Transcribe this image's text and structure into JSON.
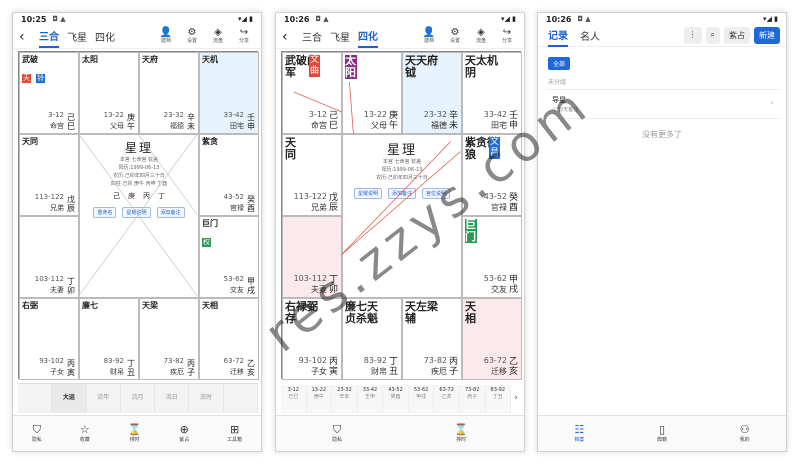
{
  "watermark": "res.zzys.com",
  "phone1": {
    "status": {
      "time": "10:25",
      "icons": "◘ ▲",
      "right": "▾◢ ▮"
    },
    "tabs": [
      "三合",
      "飞星",
      "四化"
    ],
    "actions": [
      {
        "icon": "👤",
        "label": "建档"
      },
      {
        "icon": "⚙",
        "label": "设置"
      },
      {
        "icon": "◈",
        "label": "流盘"
      },
      {
        "icon": "↪",
        "label": "分享"
      }
    ],
    "center": {
      "title": "星理",
      "lines": [
        "本宫 七命宫 钦差",
        "阳历:1999-06-13",
        "农历:己卯年四月三十日",
        "四柱 己卯 庚午 丙申 丁酉"
      ],
      "pillars": [
        "己",
        "庚",
        "丙",
        "丁"
      ],
      "buttons": [
        "重命名",
        "星曜说明",
        "添加备注"
      ]
    },
    "cells": [
      {
        "stars": "武破",
        "badges": [
          "天",
          "铃"
        ],
        "range": "3-12",
        "palace": "命宫",
        "branch": "己巳"
      },
      {
        "stars": "太阳",
        "badges": [],
        "range": "13-22",
        "palace": "父母",
        "branch": "庚午"
      },
      {
        "stars": "天府",
        "badges": [],
        "range": "23-32",
        "palace": "福德",
        "branch": "辛未"
      },
      {
        "stars": "天机",
        "badges": [],
        "range": "33-42",
        "palace": "田宅",
        "branch": "壬申"
      },
      {
        "stars": "天同",
        "badges": [],
        "range": "113-122",
        "palace": "兄弟",
        "branch": "戊辰"
      },
      {
        "stars": "紫贪",
        "badges": [],
        "range": "43-52",
        "palace": "官禄",
        "branch": "癸酉"
      },
      {
        "stars": "",
        "badges": [],
        "range": "103-112",
        "palace": "夫妻",
        "branch": "丁卯"
      },
      {
        "stars": "巨门",
        "badges": [
          "权"
        ],
        "range": "53-62",
        "palace": "交友",
        "branch": "甲戌"
      },
      {
        "stars": "右弼",
        "badges": [],
        "range": "93-102",
        "palace": "子女",
        "branch": "丙寅"
      },
      {
        "stars": "廉七",
        "badges": [],
        "range": "83-92",
        "palace": "财帛",
        "branch": "丁丑"
      },
      {
        "stars": "天梁",
        "badges": [],
        "range": "73-82",
        "palace": "疾厄",
        "branch": "丙子"
      },
      {
        "stars": "天相",
        "badges": [],
        "range": "63-72",
        "palace": "迁移",
        "branch": "乙亥"
      }
    ],
    "strip": [
      "",
      "大运",
      "流年",
      "流月",
      "流日",
      "流时",
      ""
    ],
    "bottom": [
      {
        "icon": "⛉",
        "label": "隐私"
      },
      {
        "icon": "☆",
        "label": "收藏"
      },
      {
        "icon": "⌛",
        "label": "排时"
      },
      {
        "icon": "⊕",
        "label": "紫占"
      },
      {
        "icon": "⊞",
        "label": "工具箱"
      }
    ]
  },
  "phone2": {
    "status": {
      "time": "10:26",
      "icons": "◘ ▲",
      "right": "▾◢ ▮"
    },
    "tabs": [
      "三合",
      "飞星",
      "四化"
    ],
    "actions": [
      {
        "icon": "👤",
        "label": "建档"
      },
      {
        "icon": "⚙",
        "label": "设置"
      },
      {
        "icon": "◈",
        "label": "流盘"
      },
      {
        "icon": "↪",
        "label": "分享"
      }
    ],
    "center": {
      "title": "星理",
      "lines": [
        "本宫 七命宫 钦差",
        "阳历:1999-06-13",
        "农历:己卯年四月三十日"
      ],
      "buttons": [
        "星曜说明",
        "添加备注",
        "宫位说明"
      ]
    },
    "cells": [
      {
        "stars": "武破曲军",
        "badges": [
          "文曲"
        ],
        "range": "3-12",
        "palace": "命宫",
        "branch": "己巳"
      },
      {
        "stars": "太阳",
        "badges": [],
        "range": "13-22",
        "palace": "父母",
        "branch": "庚午"
      },
      {
        "stars": "天天府钺",
        "badges": [],
        "range": "23-32",
        "palace": "福德",
        "branch": "辛未"
      },
      {
        "stars": "天太机阴",
        "badges": [],
        "range": "33-42",
        "palace": "田宅",
        "branch": "壬申"
      },
      {
        "stars": "天同",
        "badges": [],
        "range": "113-122",
        "palace": "兄弟",
        "branch": "戊辰"
      },
      {
        "stars": "紫贪微狼",
        "badges": [
          "文昌"
        ],
        "range": "43-52",
        "palace": "官禄",
        "branch": "癸酉"
      },
      {
        "stars": "",
        "badges": [],
        "range": "103-112",
        "palace": "夫妻",
        "branch": "丁卯"
      },
      {
        "stars": "巨门",
        "badges": [],
        "range": "53-62",
        "palace": "交友",
        "branch": "甲戌"
      },
      {
        "stars": "右禄弼存",
        "badges": [],
        "range": "93-102",
        "palace": "子女",
        "branch": "丙寅"
      },
      {
        "stars": "廉七天贞杀魁",
        "badges": [],
        "range": "83-92",
        "palace": "财帛",
        "branch": "丁丑"
      },
      {
        "stars": "天左梁辅",
        "badges": [],
        "range": "73-82",
        "palace": "疾厄",
        "branch": "丙子"
      },
      {
        "stars": "天相",
        "badges": [],
        "range": "63-72",
        "palace": "迁移",
        "branch": "乙亥"
      }
    ],
    "decades": [
      {
        "range": "3-12",
        "name": "己巳"
      },
      {
        "range": "13-22",
        "name": "庚午"
      },
      {
        "range": "23-32",
        "name": "辛未"
      },
      {
        "range": "33-42",
        "name": "壬申"
      },
      {
        "range": "43-52",
        "name": "癸酉"
      },
      {
        "range": "53-62",
        "name": "甲戌"
      },
      {
        "range": "63-72",
        "name": "乙亥"
      },
      {
        "range": "73-82",
        "name": "丙子"
      },
      {
        "range": "83-92",
        "name": "丁丑"
      }
    ],
    "bottom": [
      {
        "icon": "⛉",
        "label": "隐私"
      },
      {
        "icon": "⌛",
        "label": "排时"
      }
    ]
  },
  "phone3": {
    "status": {
      "time": "10:26",
      "icons": "◘ ▲",
      "right": "▾◢ ▮"
    },
    "tabs": [
      "记录",
      "名人"
    ],
    "buttons": [
      "⋮",
      "⌕",
      "紫占",
      "新建"
    ],
    "chip": "全部",
    "group": "未分组",
    "item": {
      "title": "导星",
      "sub": "☉ 暂无备注"
    },
    "empty": "没有更多了",
    "bottom": [
      {
        "icon": "☷",
        "label": "档案"
      },
      {
        "icon": "▯",
        "label": "典籍"
      },
      {
        "icon": "⚇",
        "label": "我的"
      }
    ]
  }
}
